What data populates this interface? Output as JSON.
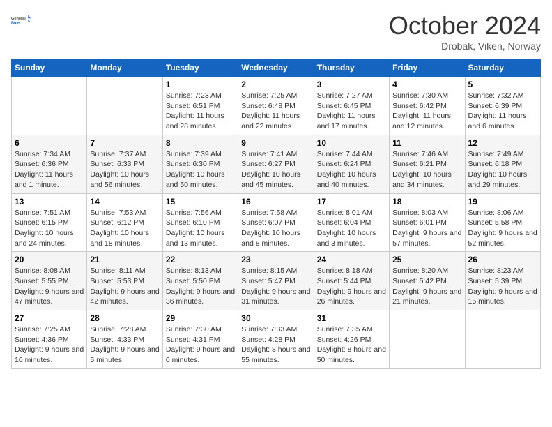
{
  "header": {
    "logo_general": "General",
    "logo_blue": "Blue",
    "title": "October 2024",
    "location": "Drobak, Viken, Norway"
  },
  "weekdays": [
    "Sunday",
    "Monday",
    "Tuesday",
    "Wednesday",
    "Thursday",
    "Friday",
    "Saturday"
  ],
  "weeks": [
    [
      {
        "day": "",
        "info": ""
      },
      {
        "day": "",
        "info": ""
      },
      {
        "day": "1",
        "info": "Sunrise: 7:23 AM\nSunset: 6:51 PM\nDaylight: 11 hours and 28 minutes."
      },
      {
        "day": "2",
        "info": "Sunrise: 7:25 AM\nSunset: 6:48 PM\nDaylight: 11 hours and 22 minutes."
      },
      {
        "day": "3",
        "info": "Sunrise: 7:27 AM\nSunset: 6:45 PM\nDaylight: 11 hours and 17 minutes."
      },
      {
        "day": "4",
        "info": "Sunrise: 7:30 AM\nSunset: 6:42 PM\nDaylight: 11 hours and 12 minutes."
      },
      {
        "day": "5",
        "info": "Sunrise: 7:32 AM\nSunset: 6:39 PM\nDaylight: 11 hours and 6 minutes."
      }
    ],
    [
      {
        "day": "6",
        "info": "Sunrise: 7:34 AM\nSunset: 6:36 PM\nDaylight: 11 hours and 1 minute."
      },
      {
        "day": "7",
        "info": "Sunrise: 7:37 AM\nSunset: 6:33 PM\nDaylight: 10 hours and 56 minutes."
      },
      {
        "day": "8",
        "info": "Sunrise: 7:39 AM\nSunset: 6:30 PM\nDaylight: 10 hours and 50 minutes."
      },
      {
        "day": "9",
        "info": "Sunrise: 7:41 AM\nSunset: 6:27 PM\nDaylight: 10 hours and 45 minutes."
      },
      {
        "day": "10",
        "info": "Sunrise: 7:44 AM\nSunset: 6:24 PM\nDaylight: 10 hours and 40 minutes."
      },
      {
        "day": "11",
        "info": "Sunrise: 7:46 AM\nSunset: 6:21 PM\nDaylight: 10 hours and 34 minutes."
      },
      {
        "day": "12",
        "info": "Sunrise: 7:49 AM\nSunset: 6:18 PM\nDaylight: 10 hours and 29 minutes."
      }
    ],
    [
      {
        "day": "13",
        "info": "Sunrise: 7:51 AM\nSunset: 6:15 PM\nDaylight: 10 hours and 24 minutes."
      },
      {
        "day": "14",
        "info": "Sunrise: 7:53 AM\nSunset: 6:12 PM\nDaylight: 10 hours and 18 minutes."
      },
      {
        "day": "15",
        "info": "Sunrise: 7:56 AM\nSunset: 6:10 PM\nDaylight: 10 hours and 13 minutes."
      },
      {
        "day": "16",
        "info": "Sunrise: 7:58 AM\nSunset: 6:07 PM\nDaylight: 10 hours and 8 minutes."
      },
      {
        "day": "17",
        "info": "Sunrise: 8:01 AM\nSunset: 6:04 PM\nDaylight: 10 hours and 3 minutes."
      },
      {
        "day": "18",
        "info": "Sunrise: 8:03 AM\nSunset: 6:01 PM\nDaylight: 9 hours and 57 minutes."
      },
      {
        "day": "19",
        "info": "Sunrise: 8:06 AM\nSunset: 5:58 PM\nDaylight: 9 hours and 52 minutes."
      }
    ],
    [
      {
        "day": "20",
        "info": "Sunrise: 8:08 AM\nSunset: 5:55 PM\nDaylight: 9 hours and 47 minutes."
      },
      {
        "day": "21",
        "info": "Sunrise: 8:11 AM\nSunset: 5:53 PM\nDaylight: 9 hours and 42 minutes."
      },
      {
        "day": "22",
        "info": "Sunrise: 8:13 AM\nSunset: 5:50 PM\nDaylight: 9 hours and 36 minutes."
      },
      {
        "day": "23",
        "info": "Sunrise: 8:15 AM\nSunset: 5:47 PM\nDaylight: 9 hours and 31 minutes."
      },
      {
        "day": "24",
        "info": "Sunrise: 8:18 AM\nSunset: 5:44 PM\nDaylight: 9 hours and 26 minutes."
      },
      {
        "day": "25",
        "info": "Sunrise: 8:20 AM\nSunset: 5:42 PM\nDaylight: 9 hours and 21 minutes."
      },
      {
        "day": "26",
        "info": "Sunrise: 8:23 AM\nSunset: 5:39 PM\nDaylight: 9 hours and 15 minutes."
      }
    ],
    [
      {
        "day": "27",
        "info": "Sunrise: 7:25 AM\nSunset: 4:36 PM\nDaylight: 9 hours and 10 minutes."
      },
      {
        "day": "28",
        "info": "Sunrise: 7:28 AM\nSunset: 4:33 PM\nDaylight: 9 hours and 5 minutes."
      },
      {
        "day": "29",
        "info": "Sunrise: 7:30 AM\nSunset: 4:31 PM\nDaylight: 9 hours and 0 minutes."
      },
      {
        "day": "30",
        "info": "Sunrise: 7:33 AM\nSunset: 4:28 PM\nDaylight: 8 hours and 55 minutes."
      },
      {
        "day": "31",
        "info": "Sunrise: 7:35 AM\nSunset: 4:26 PM\nDaylight: 8 hours and 50 minutes."
      },
      {
        "day": "",
        "info": ""
      },
      {
        "day": "",
        "info": ""
      }
    ]
  ]
}
